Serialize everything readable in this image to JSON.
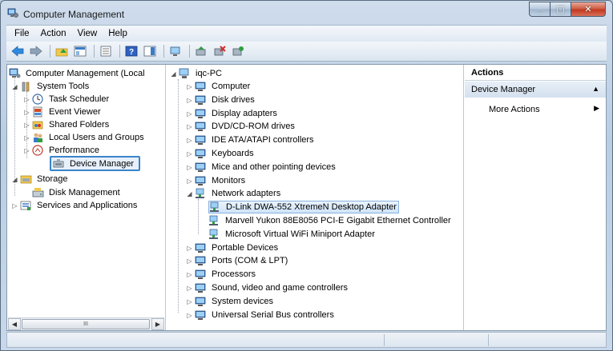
{
  "window": {
    "title": "Computer Management",
    "controls": {
      "minimize": "_",
      "maximize": "▢",
      "close": "✕"
    }
  },
  "menu": [
    "File",
    "Action",
    "View",
    "Help"
  ],
  "toolbar": [
    "back-icon",
    "forward-icon",
    "up-folder-icon",
    "show-hide-tree-icon",
    "properties-icon",
    "help-icon",
    "show-action-pane-icon",
    "computer-scan-icon",
    "update-driver-icon",
    "disable-device-icon",
    "uninstall-icon"
  ],
  "tree": {
    "root": "Computer Management (Local",
    "system_tools": "System Tools",
    "task_scheduler": "Task Scheduler",
    "event_viewer": "Event Viewer",
    "shared_folders": "Shared Folders",
    "local_users": "Local Users and Groups",
    "performance": "Performance",
    "device_manager": "Device Manager",
    "storage": "Storage",
    "disk_management": "Disk Management",
    "services": "Services and Applications"
  },
  "scroll": {
    "left": "◀",
    "right": "▶",
    "grip": "III"
  },
  "devices": {
    "root": "iqc-PC",
    "items": [
      "Computer",
      "Disk drives",
      "Display adapters",
      "DVD/CD-ROM drives",
      "IDE ATA/ATAPI controllers",
      "Keyboards",
      "Mice and other pointing devices",
      "Monitors",
      "Network adapters"
    ],
    "network_children": [
      "D-Link DWA-552 XtremeN Desktop Adapter",
      "Marvell Yukon 88E8056 PCI-E Gigabit Ethernet Controller",
      "Microsoft Virtual WiFi Miniport Adapter"
    ],
    "after": [
      "Portable Devices",
      "Ports (COM & LPT)",
      "Processors",
      "Sound, video and game controllers",
      "System devices",
      "Universal Serial Bus controllers"
    ]
  },
  "actions": {
    "header": "Actions",
    "section": "Device Manager",
    "more": "More Actions",
    "collapse": "▲",
    "more_arrow": "▶"
  }
}
